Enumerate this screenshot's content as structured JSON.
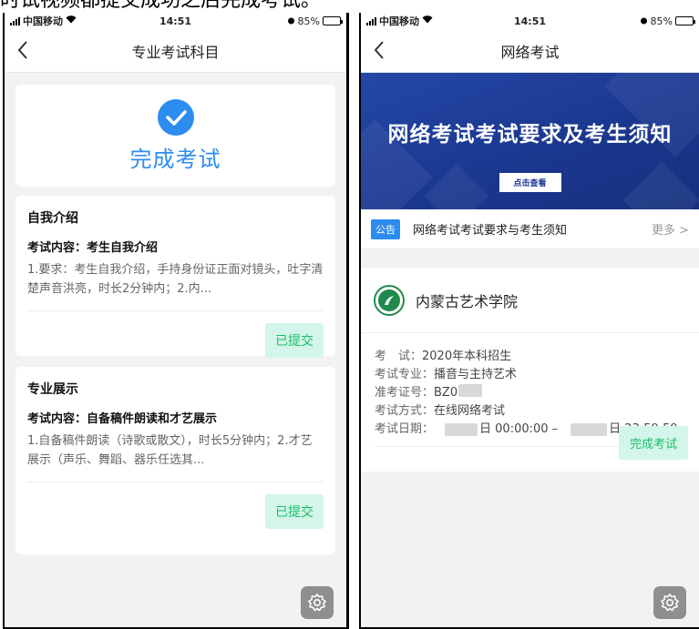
{
  "caption": "时试视频都提交成功之后完成考试。",
  "left": {
    "status": {
      "carrier": "中国移动",
      "time": "14:51",
      "battery": "85%",
      "battery_level": 0.85
    },
    "nav": {
      "back_icon": "chevron-left-icon",
      "title": "专业考试科目"
    },
    "done_card": {
      "icon": "check-circle-icon",
      "title": "完成考试"
    },
    "tasks": [
      {
        "title": "自我介绍",
        "content": "考试内容：考生自我介绍",
        "desc": "1.要求：考生自我介绍，手持身份证正面对镜头，吐字清楚声音洪亮，时长2分钟内；2.内...",
        "status_label": "已提交"
      },
      {
        "title": "专业展示",
        "content": "考试内容：自备稿件朗读和才艺展示",
        "desc": "1.自备稿件朗读（诗歌或散文），时长5分钟内；2.才艺展示（声乐、舞蹈、器乐任选其...",
        "status_label": "已提交"
      }
    ],
    "gear_icon": "gear-icon"
  },
  "right": {
    "status": {
      "carrier": "中国移动",
      "time": "14:51",
      "battery": "85%",
      "battery_level": 0.85
    },
    "nav": {
      "back_icon": "chevron-left-icon",
      "title": "网络考试"
    },
    "banner": {
      "title": "网络考试考试要求及考生须知",
      "button": "点击查看"
    },
    "notice": {
      "tag": "公告",
      "text": "网络考试考试要求与考生须知",
      "more": "更多 >"
    },
    "school": {
      "name": "内蒙古艺术学院",
      "exam_label": "考　试：",
      "exam_value": "2020年本科招生",
      "major_label": "考试专业：",
      "major_value": "播音与主持艺术",
      "ticket_label": "准考证号：",
      "ticket_value": "BZ0",
      "mode_label": "考试方式：",
      "mode_value": "在线网络考试",
      "date_label": "考试日期：",
      "date_start_tail": "日 00:00:00 –",
      "date_end_tail": "日 23:59:59",
      "finish_button": "完成考试"
    },
    "gear_icon": "gear-icon"
  },
  "colors": {
    "primary": "#2d8cf0",
    "success": "#19be6b",
    "success_bg": "#d4f5e9",
    "banner": "#1b3890"
  }
}
